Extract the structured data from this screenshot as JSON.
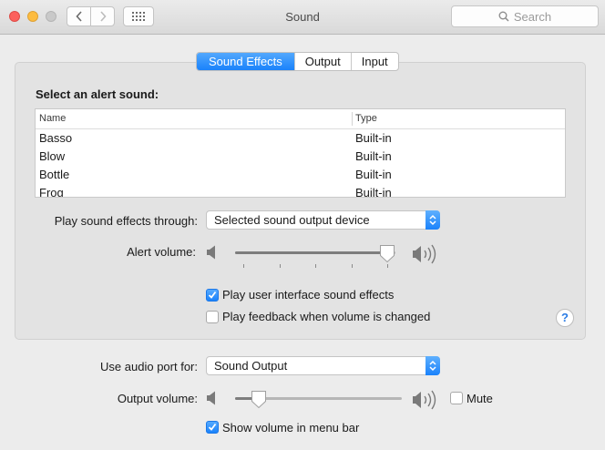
{
  "window": {
    "title": "Sound"
  },
  "toolbar": {
    "search_placeholder": "Search"
  },
  "tabs": [
    {
      "label": "Sound Effects",
      "active": true
    },
    {
      "label": "Output",
      "active": false
    },
    {
      "label": "Input",
      "active": false
    }
  ],
  "sound_effects": {
    "section_title": "Select an alert sound:",
    "table": {
      "columns": [
        "Name",
        "Type"
      ],
      "rows": [
        {
          "name": "Basso",
          "type": "Built-in"
        },
        {
          "name": "Blow",
          "type": "Built-in"
        },
        {
          "name": "Bottle",
          "type": "Built-in"
        },
        {
          "name": "Frog",
          "type": "Built-in"
        }
      ]
    },
    "play_through": {
      "label": "Play sound effects through:",
      "value": "Selected sound output device"
    },
    "alert_volume": {
      "label": "Alert volume:",
      "level": 1.0
    },
    "checkboxes": [
      {
        "label": "Play user interface sound effects",
        "checked": true
      },
      {
        "label": "Play feedback when volume is changed",
        "checked": false
      }
    ],
    "help": "?"
  },
  "footer": {
    "audio_port": {
      "label": "Use audio port for:",
      "value": "Sound Output"
    },
    "output_volume": {
      "label": "Output volume:",
      "level": 0.1
    },
    "mute": {
      "label": "Mute",
      "checked": false
    },
    "show_volume": {
      "label": "Show volume in menu bar",
      "checked": true
    }
  },
  "colors": {
    "accent": "#1a82fb",
    "background": "#ececec",
    "group_bg": "#e3e3e3"
  },
  "icons": [
    "chevron-left-icon",
    "chevron-right-icon",
    "grid-icon",
    "search-icon",
    "speaker-low-icon",
    "speaker-high-icon",
    "question-icon"
  ]
}
